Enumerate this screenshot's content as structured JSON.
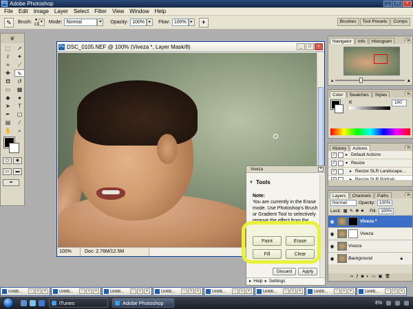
{
  "titlebar": {
    "title": "Adobe Photoshop",
    "app_icon": "Ps"
  },
  "menu": [
    "File",
    "Edit",
    "Image",
    "Layer",
    "Select",
    "Filter",
    "View",
    "Window",
    "Help"
  ],
  "options": {
    "brush_label": "Brush:",
    "brush_size": "13",
    "mode_label": "Mode:",
    "mode_value": "Normal",
    "opacity_label": "Opacity:",
    "opacity_value": "100%",
    "flow_label": "Flow:",
    "flow_value": "100%"
  },
  "palette_well": [
    "Brushes",
    "Tool Presets",
    "Comps"
  ],
  "document": {
    "title": "DSC_0105.NEF @ 100% (Viveza *, Layer Mask/8)",
    "zoom": "100%",
    "doc_info": "Doc: 2.76M/12.5M"
  },
  "viveza": {
    "panel_title": "Viveza",
    "tools_header": "Tools",
    "note_title": "Note:",
    "note_text": "You are currently in the Erase mode. Use Photoshop's Brush or Gradient Tool to selectively remove the effect from the",
    "buttons": {
      "paint": "Paint",
      "erase": "Erase",
      "fill": "Fill",
      "clear": "Clear"
    },
    "discard": "Discard",
    "apply": "Apply",
    "help": "Help",
    "settings": "Settings"
  },
  "navigator": {
    "tabs": [
      "Navigator",
      "Info",
      "Histogram"
    ]
  },
  "color": {
    "tabs": [
      "Color",
      "Swatches",
      "Styles"
    ],
    "channel": "K",
    "value": "100"
  },
  "history": {
    "tabs": [
      "History",
      "Actions"
    ],
    "items": [
      "Default Actions",
      "Resize",
      "Resize SLR Landscape...",
      "Resize SLR Portrait"
    ]
  },
  "layers": {
    "tabs": [
      "Layers",
      "Channels",
      "Paths"
    ],
    "blend": "Normal",
    "opacity_label": "Opacity:",
    "opacity": "100%",
    "lock_label": "Lock:",
    "fill_label": "Fill:",
    "fill": "100%",
    "items": [
      "Viveza *",
      "Viveza",
      "Viveza",
      "Background"
    ]
  },
  "minimized_docs": [
    "Untitl...",
    "Untitl...",
    "Untitl...",
    "Untitl...",
    "Untitl...",
    "Untitl...",
    "Untitl...",
    "Untitl..."
  ],
  "taskbar": {
    "items": [
      "iTunes",
      "Adobe Photoshop"
    ],
    "lang": "EN"
  }
}
